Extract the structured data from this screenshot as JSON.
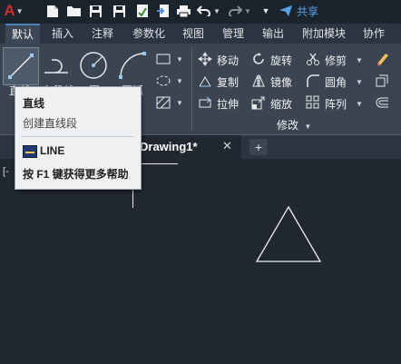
{
  "quick_access": {
    "app_letter": "A",
    "share_label": "共享"
  },
  "ribbon_tabs": [
    {
      "label": "默认",
      "active": true
    },
    {
      "label": "插入"
    },
    {
      "label": "注释"
    },
    {
      "label": "参数化"
    },
    {
      "label": "视图"
    },
    {
      "label": "管理"
    },
    {
      "label": "输出"
    },
    {
      "label": "附加模块"
    },
    {
      "label": "协作"
    }
  ],
  "draw_panel": {
    "line_label": "直线",
    "polyline_label": "多段线",
    "circle_label": "圆",
    "arc_label": "圆弧"
  },
  "modify_panel": {
    "title": "修改",
    "move": "移动",
    "rotate": "旋转",
    "trim": "修剪",
    "copy": "复制",
    "mirror": "镜像",
    "fillet": "圆角",
    "stretch": "拉伸",
    "scale": "缩放",
    "array": "阵列"
  },
  "document": {
    "tab_title": "Drawing1*",
    "viewport_label": "[-"
  },
  "tooltip": {
    "title": "直线",
    "description": "创建直线段",
    "command": "LINE",
    "help": "按 F1 键获得更多帮助"
  },
  "colors": {
    "canvas": "#212830",
    "ribbon": "#3b4552",
    "accent_blue": "#4f7fb8",
    "app_red": "#d62b2b"
  }
}
